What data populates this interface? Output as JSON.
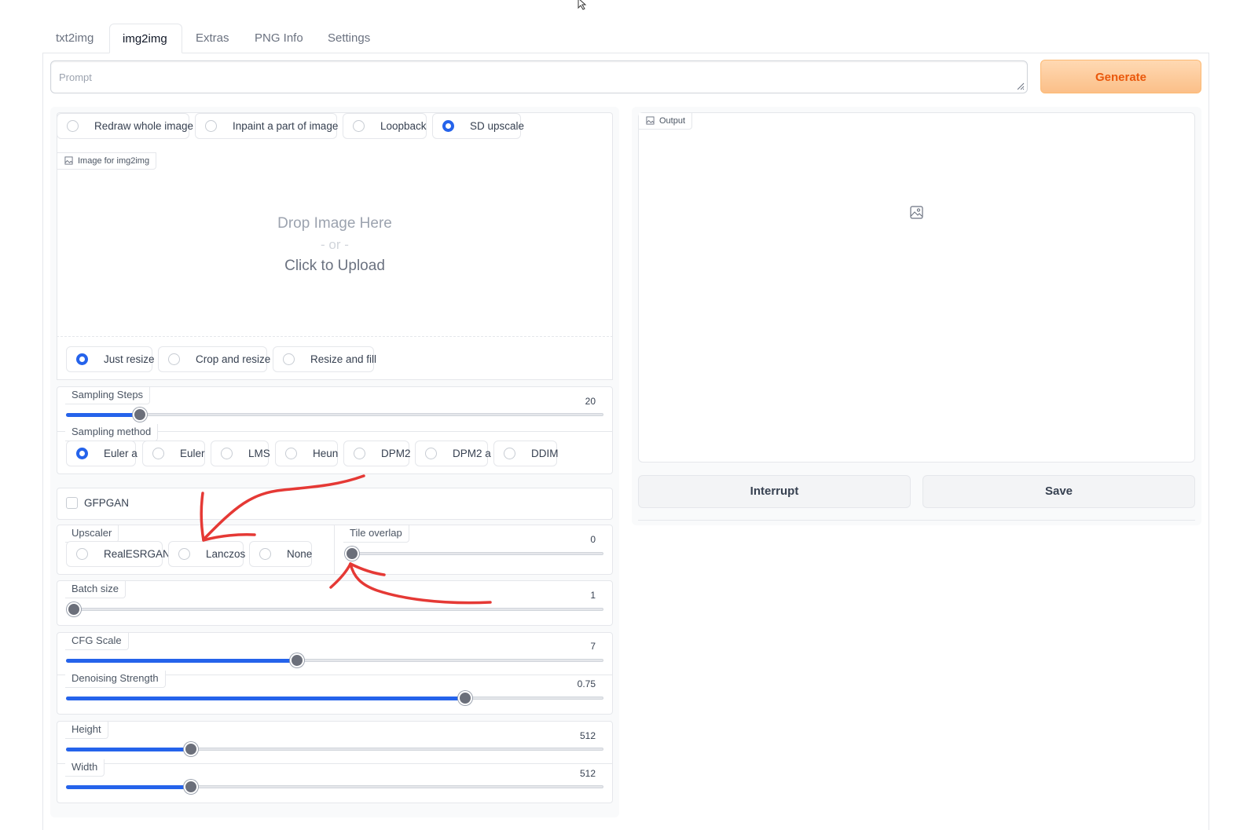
{
  "tabs": [
    "txt2img",
    "img2img",
    "Extras",
    "PNG Info",
    "Settings"
  ],
  "active_tab": "img2img",
  "prompt": {
    "placeholder": "Prompt"
  },
  "generate_label": "Generate",
  "mode_options": [
    "Redraw whole image",
    "Inpaint a part of image",
    "Loopback",
    "SD upscale"
  ],
  "mode_selected": "SD upscale",
  "image_input": {
    "label": "Image for img2img",
    "drop_text": "Drop Image Here",
    "or_text": "- or -",
    "click_text": "Click to Upload"
  },
  "resize_options": [
    "Just resize",
    "Crop and resize",
    "Resize and fill"
  ],
  "resize_selected": "Just resize",
  "sampling_steps": {
    "label": "Sampling Steps",
    "value": "20",
    "fraction": 0.14
  },
  "sampling_method": {
    "label": "Sampling method",
    "options": [
      "Euler a",
      "Euler",
      "LMS",
      "Heun",
      "DPM2",
      "DPM2 a",
      "DDIM"
    ],
    "selected": "Euler a"
  },
  "gfpgan": {
    "label": "GFPGAN",
    "checked": false
  },
  "upscaler": {
    "label": "Upscaler",
    "options": [
      "RealESRGAN",
      "Lanczos",
      "None"
    ],
    "selected": null
  },
  "tile_overlap": {
    "label": "Tile overlap",
    "value": "0",
    "fraction": 0.0
  },
  "batch_size": {
    "label": "Batch size",
    "value": "1",
    "fraction": 0.0
  },
  "cfg_scale": {
    "label": "CFG Scale",
    "value": "7",
    "fraction": 0.43
  },
  "denoising_strength": {
    "label": "Denoising Strength",
    "value": "0.75",
    "fraction": 0.75
  },
  "height": {
    "label": "Height",
    "value": "512",
    "fraction": 0.23
  },
  "width": {
    "label": "Width",
    "value": "512",
    "fraction": 0.23
  },
  "output": {
    "label": "Output"
  },
  "interrupt_label": "Interrupt",
  "save_label": "Save",
  "colors": {
    "accent": "#2563eb",
    "generate_text": "#ea580c",
    "annotation": "#e53935"
  }
}
